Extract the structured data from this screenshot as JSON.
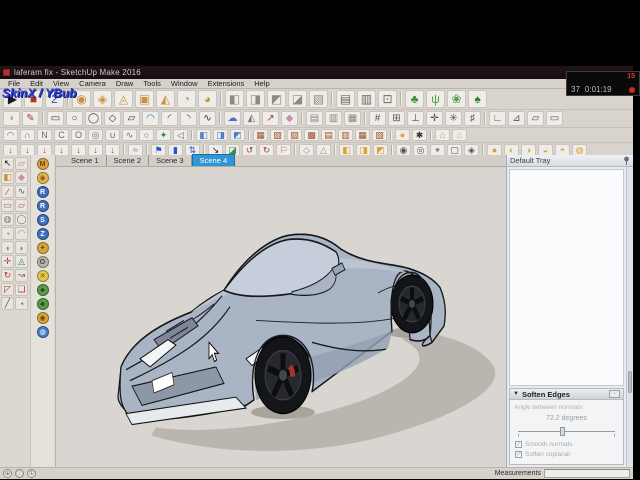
{
  "titlebar": {
    "title": "laferam fix - SketchUp Make 2016"
  },
  "watermark": {
    "text": "SkinX / YBub"
  },
  "recorder": {
    "badge": "15",
    "counter": "37",
    "time": "0:01:19"
  },
  "menu": {
    "items": [
      {
        "name": "menu-file",
        "label": "File"
      },
      {
        "name": "menu-edit",
        "label": "Edit"
      },
      {
        "name": "menu-view",
        "label": "View"
      },
      {
        "name": "menu-camera",
        "label": "Camera"
      },
      {
        "name": "menu-draw",
        "label": "Draw"
      },
      {
        "name": "menu-tools",
        "label": "Tools"
      },
      {
        "name": "menu-window",
        "label": "Window"
      },
      {
        "name": "menu-extensions",
        "label": "Extensions"
      },
      {
        "name": "menu-help",
        "label": "Help"
      }
    ]
  },
  "toolbars": {
    "row1": [
      {
        "name": "play-icon",
        "g": "▶",
        "c": "#1a1a1a"
      },
      {
        "name": "stop-icon",
        "g": "■",
        "c": "#b23425"
      },
      {
        "name": "plugin-2-icon",
        "g": "2",
        "c": "#2b4fd0"
      },
      {
        "sep": true
      },
      {
        "name": "sandbox-from-contours-icon",
        "g": "◉",
        "c": "#c9913c"
      },
      {
        "name": "sandbox-from-scratch-icon",
        "g": "◈",
        "c": "#c9913c"
      },
      {
        "name": "smoove-icon",
        "g": "◬",
        "c": "#c9913c"
      },
      {
        "name": "stamp-icon",
        "g": "▣",
        "c": "#c9913c"
      },
      {
        "name": "drape-icon",
        "g": "◭",
        "c": "#c9913c"
      },
      {
        "name": "add-detail-icon",
        "g": "◔",
        "c": "#c9913c"
      },
      {
        "name": "flip-edge-icon",
        "g": "◕",
        "c": "#c9913c"
      },
      {
        "sep": true
      },
      {
        "name": "solid-union-icon",
        "g": "◧",
        "c": "#8f8a7e"
      },
      {
        "name": "solid-subtract-icon",
        "g": "◨",
        "c": "#8f8a7e"
      },
      {
        "name": "solid-trim-icon",
        "g": "◩",
        "c": "#8f8a7e"
      },
      {
        "name": "solid-intersect-icon",
        "g": "◪",
        "c": "#8f8a7e"
      },
      {
        "name": "solid-split-icon",
        "g": "▧",
        "c": "#8f8a7e"
      },
      {
        "sep": true
      },
      {
        "name": "rock-tool-icon",
        "g": "▤",
        "c": "#6b675f"
      },
      {
        "name": "cliff-tool-icon",
        "g": "▥",
        "c": "#6b675f"
      },
      {
        "name": "boulder-tool-icon",
        "g": "⊡",
        "c": "#6b675f"
      },
      {
        "sep": true
      },
      {
        "name": "tree-maker-icon",
        "g": "♣",
        "c": "#3f8f3a"
      },
      {
        "name": "grass-maker-icon",
        "g": "ψ",
        "c": "#4f9f4a"
      },
      {
        "name": "leaf-maker-icon",
        "g": "❀",
        "c": "#4f9f4a"
      },
      {
        "name": "bush-maker-icon",
        "g": "♠",
        "c": "#2f7f2f"
      }
    ],
    "row2": [
      {
        "name": "arc-half-icon",
        "g": "◖",
        "c": "#b79c7a"
      },
      {
        "name": "pencil-icon",
        "g": "✎",
        "c": "#b3342e"
      },
      {
        "sep": true
      },
      {
        "name": "rectangle-icon",
        "g": "▭",
        "c": "#3a3a3a"
      },
      {
        "name": "circle-icon",
        "g": "○",
        "c": "#3a3a3a"
      },
      {
        "name": "ellipse-icon",
        "g": "◯",
        "c": "#3a3a3a"
      },
      {
        "name": "polygon-icon",
        "g": "◇",
        "c": "#3a3a3a"
      },
      {
        "name": "parallelogram-icon",
        "g": "▱",
        "c": "#3a3a3a"
      },
      {
        "name": "arc-icon",
        "g": "◠",
        "c": "#3a6fb0"
      },
      {
        "name": "arc-2pt-icon",
        "g": "◜",
        "c": "#3a3a3a"
      },
      {
        "name": "arc-3pt-icon",
        "g": "◝",
        "c": "#3a3a3a"
      },
      {
        "name": "freehand-icon",
        "g": "∿",
        "c": "#3a3a3a"
      },
      {
        "sep": true
      },
      {
        "name": "cloud-tool-icon",
        "g": "☁",
        "c": "#4a6fd1"
      },
      {
        "name": "face-tool-icon",
        "g": "◭",
        "c": "#777777"
      },
      {
        "name": "dim-arrow-icon",
        "g": "↗",
        "c": "#c0392b"
      },
      {
        "name": "soap-skin-icon",
        "g": "◆",
        "c": "#d08bb0"
      },
      {
        "sep": true
      },
      {
        "name": "copy-along-icon",
        "g": "▤",
        "c": "#8a867c"
      },
      {
        "name": "copy-array-icon",
        "g": "▥",
        "c": "#8a867c"
      },
      {
        "name": "copy-grid-icon",
        "g": "▦",
        "c": "#8a867c"
      },
      {
        "sep": true
      },
      {
        "name": "grid-tool-icon",
        "g": "#",
        "c": "#555555"
      },
      {
        "name": "grid-plane-icon",
        "g": "⊞",
        "c": "#555555"
      },
      {
        "name": "axes-helper-icon",
        "g": "⊥",
        "c": "#555555"
      },
      {
        "name": "crosshair-icon",
        "g": "✛",
        "c": "#555555"
      },
      {
        "name": "snap-star-icon",
        "g": "✳",
        "c": "#555555"
      },
      {
        "name": "hatch-icon",
        "g": "♯",
        "c": "#555555"
      },
      {
        "sep": true
      },
      {
        "name": "construct-corner-icon",
        "g": "∟",
        "c": "#555555"
      },
      {
        "name": "construct-tri-icon",
        "g": "⊿",
        "c": "#555555"
      },
      {
        "name": "construct-plane-icon",
        "g": "▱",
        "c": "#555555"
      },
      {
        "name": "construct-box-icon",
        "g": "▭",
        "c": "#555555"
      }
    ],
    "row3": [
      {
        "name": "curve-arch-icon",
        "g": "◠",
        "c": "#6a6a78"
      },
      {
        "name": "curve-cap-icon",
        "g": "∩",
        "c": "#6a6a78"
      },
      {
        "name": "curve-n-icon",
        "g": "N",
        "c": "#6a6a78"
      },
      {
        "name": "curve-c-icon",
        "g": "C",
        "c": "#6a6a78"
      },
      {
        "name": "curve-o-icon",
        "g": "O",
        "c": "#6a6a78"
      },
      {
        "name": "curve-spiral-icon",
        "g": "◎",
        "c": "#6a6a78"
      },
      {
        "name": "curve-u-icon",
        "g": "∪",
        "c": "#6a6a78"
      },
      {
        "name": "curve-s-icon",
        "g": "∿",
        "c": "#6a6a78"
      },
      {
        "name": "curve-loop-icon",
        "g": "○",
        "c": "#6a6a78"
      },
      {
        "name": "curve-star-icon",
        "g": "✦",
        "c": "#3f7f3f"
      },
      {
        "name": "curve-tri-icon",
        "g": "◁",
        "c": "#6a6a78"
      },
      {
        "sep": true
      },
      {
        "name": "cube-blue-1-icon",
        "g": "◧",
        "c": "#4a7fc9"
      },
      {
        "name": "cube-blue-2-icon",
        "g": "◨",
        "c": "#4a7fc9"
      },
      {
        "name": "cube-blue-3-icon",
        "g": "◩",
        "c": "#4a7fc9"
      },
      {
        "sep": true
      },
      {
        "name": "terrain-tool-1-icon",
        "g": "▦",
        "c": "#a0522d"
      },
      {
        "name": "terrain-tool-2-icon",
        "g": "▧",
        "c": "#a0522d"
      },
      {
        "name": "terrain-tool-3-icon",
        "g": "▨",
        "c": "#a0522d"
      },
      {
        "name": "terrain-tool-4-icon",
        "g": "▩",
        "c": "#a0522d"
      },
      {
        "name": "terrain-tool-5-icon",
        "g": "▤",
        "c": "#a0522d"
      },
      {
        "name": "terrain-tool-6-icon",
        "g": "▥",
        "c": "#a0522d"
      },
      {
        "name": "terrain-tool-7-icon",
        "g": "▦",
        "c": "#a0522d"
      },
      {
        "name": "terrain-tool-8-icon",
        "g": "▧",
        "c": "#a0522d"
      },
      {
        "sep": true
      },
      {
        "name": "coin-tool-icon",
        "g": "●",
        "c": "#e0a12f"
      },
      {
        "name": "gear-icon",
        "g": "✱",
        "c": "#333333"
      },
      {
        "sep": true
      },
      {
        "name": "house-builder-icon",
        "g": "⌂",
        "c": "#c9913c"
      },
      {
        "name": "roof-builder-icon",
        "g": "⌂",
        "c": "#d8a23a"
      }
    ],
    "row4": [
      {
        "name": "import-tool-1-icon",
        "g": "↓",
        "c": "#b0402f"
      },
      {
        "name": "import-tool-2-icon",
        "g": "↓",
        "c": "#b0402f"
      },
      {
        "name": "import-tool-3-icon",
        "g": "↓",
        "c": "#b0402f"
      },
      {
        "name": "import-tool-4-icon",
        "g": "↓",
        "c": "#b0402f"
      },
      {
        "name": "import-tool-5-icon",
        "g": "↓",
        "c": "#b0402f"
      },
      {
        "name": "import-tool-6-icon",
        "g": "↓",
        "c": "#b0402f"
      },
      {
        "name": "import-tool-7-icon",
        "g": "↓",
        "c": "#b0402f"
      },
      {
        "sep": true
      },
      {
        "name": "equalize-icon",
        "g": "≈",
        "c": "#888888"
      },
      {
        "sep": true
      },
      {
        "name": "flag-tool-icon",
        "g": "⚑",
        "c": "#2b4fd0"
      },
      {
        "name": "bar-tool-icon",
        "g": "▮",
        "c": "#2b4fd0"
      },
      {
        "name": "swap-vert-icon",
        "g": "⇅",
        "c": "#2b4fd0"
      },
      {
        "sep": true
      },
      {
        "name": "arrow-se-icon",
        "g": "↘",
        "c": "#222222"
      },
      {
        "name": "green-clip-icon",
        "g": "◪",
        "c": "#3a8f4e"
      },
      {
        "name": "undo-curve-icon",
        "g": "↺",
        "c": "#b0402f"
      },
      {
        "name": "redo-curve-icon",
        "g": "↻",
        "c": "#b0402f"
      },
      {
        "name": "flag-red-icon",
        "g": "⚐",
        "c": "#c05050"
      },
      {
        "sep": true
      },
      {
        "name": "shield-tool-icon",
        "g": "◇",
        "c": "#8b85a8"
      },
      {
        "name": "wire-poly-icon",
        "g": "△",
        "c": "#9a958a"
      },
      {
        "sep": true
      },
      {
        "name": "gold-box-1-icon",
        "g": "◧",
        "c": "#d8a23a"
      },
      {
        "name": "gold-box-2-icon",
        "g": "◨",
        "c": "#d8a23a"
      },
      {
        "name": "gold-box-3-icon",
        "g": "◩",
        "c": "#d8a23a"
      },
      {
        "sep": true
      },
      {
        "name": "view-target-icon",
        "g": "◉",
        "c": "#555555"
      },
      {
        "name": "view-ring-icon",
        "g": "◎",
        "c": "#555555"
      },
      {
        "name": "view-crosshair-icon",
        "g": "⌖",
        "c": "#555555"
      },
      {
        "name": "view-frame-icon",
        "g": "▢",
        "c": "#555555"
      },
      {
        "name": "view-gem-icon",
        "g": "◈",
        "c": "#555555"
      },
      {
        "sep": true
      },
      {
        "name": "gold-dot-1-icon",
        "g": "●",
        "c": "#d8a23a"
      },
      {
        "name": "gold-dot-2-icon",
        "g": "◐",
        "c": "#d8a23a"
      },
      {
        "name": "gold-dot-3-icon",
        "g": "◑",
        "c": "#d8a23a"
      },
      {
        "name": "gold-dot-4-icon",
        "g": "◒",
        "c": "#d8a23a"
      },
      {
        "name": "gold-dot-5-icon",
        "g": "◓",
        "c": "#d8a23a"
      },
      {
        "name": "gold-dot-6-icon",
        "g": "◍",
        "c": "#d8a23a"
      }
    ]
  },
  "scene_tabs": {
    "tabs": [
      {
        "name": "tab-scene-1",
        "label": "Scene 1",
        "active": false
      },
      {
        "name": "tab-scene-2",
        "label": "Scene 2",
        "active": false
      },
      {
        "name": "tab-scene-3",
        "label": "Scene 3",
        "active": false
      },
      {
        "name": "tab-scene-4",
        "label": "Scene 4",
        "active": true
      }
    ]
  },
  "left_dock": {
    "tools": [
      {
        "name": "select-tool-icon",
        "g": "↖",
        "c": "#111111"
      },
      {
        "name": "eraser-tool-icon",
        "g": "▱",
        "c": "#b77777"
      },
      {
        "name": "paint-bucket-icon",
        "g": "◧",
        "c": "#c9913c"
      },
      {
        "name": "sample-material-icon",
        "g": "◆",
        "c": "#d08bb0"
      },
      {
        "name": "line-tool-icon",
        "g": "∕",
        "c": "#b3342e"
      },
      {
        "name": "freehand-tool-icon",
        "g": "∿",
        "c": "#555555"
      },
      {
        "name": "rectangle-tool-icon",
        "g": "▭",
        "c": "#a85a7a"
      },
      {
        "name": "rotated-rectangle-icon",
        "g": "▱",
        "c": "#a85a7a"
      },
      {
        "name": "circle-tool-icon",
        "g": "◍",
        "c": "#777777"
      },
      {
        "name": "polygon-tool-icon",
        "g": "◯",
        "c": "#777777"
      },
      {
        "name": "pie-tool-icon",
        "g": "◔",
        "c": "#b77777"
      },
      {
        "name": "arc-tool-icon",
        "g": "◠",
        "c": "#b77777"
      },
      {
        "name": "arc2-tool-icon",
        "g": "◖",
        "c": "#b77777"
      },
      {
        "name": "pie2-tool-icon",
        "g": "◗",
        "c": "#b77777"
      },
      {
        "name": "move-tool-icon",
        "g": "✛",
        "c": "#c0392b"
      },
      {
        "name": "push-pull-icon",
        "g": "◬",
        "c": "#3a8f4e"
      },
      {
        "name": "rotate-tool-icon",
        "g": "↻",
        "c": "#c0392b"
      },
      {
        "name": "follow-me-icon",
        "g": "↝",
        "c": "#8b4f3a"
      },
      {
        "name": "scale-tool-icon",
        "g": "◸",
        "c": "#c0392b"
      },
      {
        "name": "offset-tool-icon",
        "g": "❏",
        "c": "#c0392b"
      },
      {
        "name": "tape-measure-icon",
        "g": "╱",
        "c": "#555555"
      },
      {
        "name": "protractor-icon",
        "g": "◔",
        "c": "#555555"
      }
    ],
    "badges": [
      {
        "name": "m-plugin-badge",
        "g": "M",
        "bg": "#d7a73c",
        "c": "#6e4310"
      },
      {
        "name": "coin-badge",
        "g": "◉",
        "bg": "#e3b84e",
        "c": "#8a5a1a"
      },
      {
        "name": "r-plugin-badge",
        "g": "R",
        "bg": "#3f6fbe",
        "c": "#ffffff"
      },
      {
        "name": "rt-plugin-badge",
        "g": "R",
        "bg": "#3f6fbe",
        "c": "#ffffff"
      },
      {
        "name": "sb-plugin-badge",
        "g": "S",
        "bg": "#3f6fbe",
        "c": "#ffffff"
      },
      {
        "name": "z-plugin-badge",
        "g": "Z",
        "bg": "#3f6fbe",
        "c": "#ffffff"
      },
      {
        "name": "tag-badge",
        "g": "✦",
        "bg": "#d7a73c",
        "c": "#6e4310"
      },
      {
        "name": "o-plugin-badge",
        "g": "O",
        "bg": "#b8b4ac",
        "c": "#444444"
      },
      {
        "name": "x-plugin-badge",
        "g": "✕",
        "bg": "#e3c84e",
        "c": "#6e5a10"
      },
      {
        "name": "tree-badge-1",
        "g": "♣",
        "bg": "#5a9a4a",
        "c": "#1e4a18"
      },
      {
        "name": "tree-badge-2",
        "g": "♣",
        "bg": "#5a9a4a",
        "c": "#1e4a18"
      },
      {
        "name": "medal-badge",
        "g": "◉",
        "bg": "#d7a73c",
        "c": "#6e4310"
      },
      {
        "name": "globe-badge",
        "g": "◍",
        "bg": "#4a7fc9",
        "c": "#ffffff"
      }
    ]
  },
  "tray": {
    "title": "Default Tray",
    "soften": {
      "title": "Soften Edges",
      "collapse_glyph": "▼",
      "angle_label": "Angle between normals:",
      "angle_value": "72.2",
      "angle_unit": "degrees",
      "check_glyph": "✓",
      "checkbox1": "Smooth normals",
      "checkbox2": "Soften coplanar"
    }
  },
  "statusbar": {
    "icons": [
      {
        "name": "geolocation-icon",
        "g": "⊕"
      },
      {
        "name": "credits-icon",
        "g": "ⓘ"
      },
      {
        "name": "claim-credit-icon",
        "g": "①"
      }
    ],
    "measurements_label": "Measurements"
  },
  "colors": {
    "canvas_bg": "#d9d6d1",
    "car_body": "#a9b4c4",
    "car_glass": "#c6cedb",
    "shadow": "#bab6af",
    "active_tab": "#2f97d4"
  }
}
